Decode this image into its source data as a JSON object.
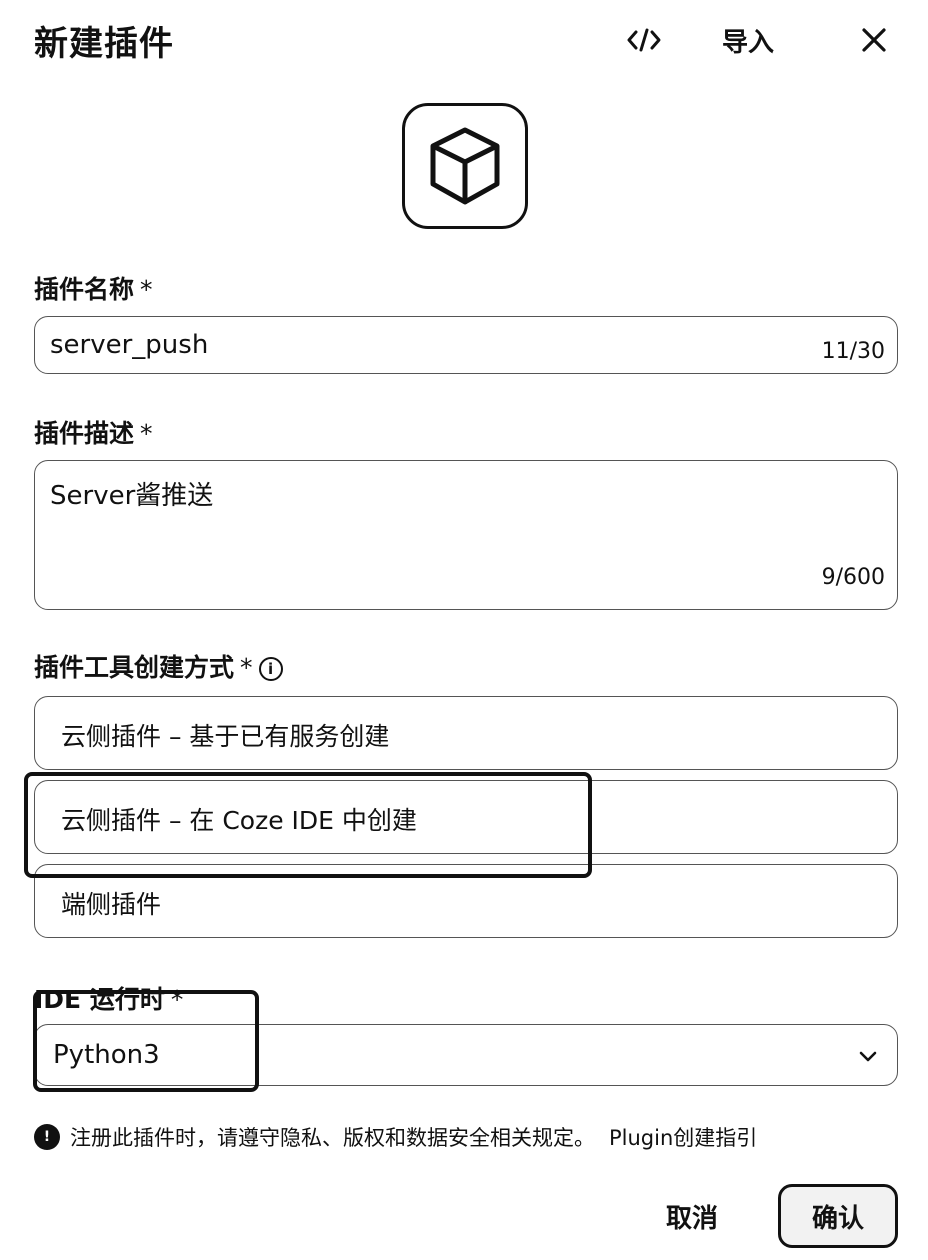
{
  "dialog": {
    "title": "新建插件",
    "code_icon": "code-icon",
    "import_label": "导入",
    "close_icon": "close-icon"
  },
  "avatar": {
    "icon": "cube-icon"
  },
  "name_field": {
    "label": "插件名称",
    "required_mark": "*",
    "value": "server_push",
    "counter": "11/30"
  },
  "desc_field": {
    "label": "插件描述",
    "required_mark": "*",
    "value": "Server酱推送",
    "counter": "9/600"
  },
  "creation_method": {
    "label": "插件工具创建方式",
    "required_mark": "*",
    "info_icon": "info-icon",
    "options": [
      {
        "label": "云侧插件 – 基于已有服务创建"
      },
      {
        "label": "云侧插件 – 在 Coze IDE 中创建",
        "selected": true
      },
      {
        "label": "端侧插件"
      }
    ]
  },
  "runtime": {
    "label": "IDE 运行时",
    "required_mark": "*",
    "value": "Python3",
    "chevron_icon": "chevron-down-icon"
  },
  "notice": {
    "icon": "warning-icon",
    "text": "注册此插件时，请遵守隐私、版权和数据安全相关规定。",
    "link": "Plugin创建指引"
  },
  "footer": {
    "cancel_label": "取消",
    "confirm_label": "确认"
  }
}
